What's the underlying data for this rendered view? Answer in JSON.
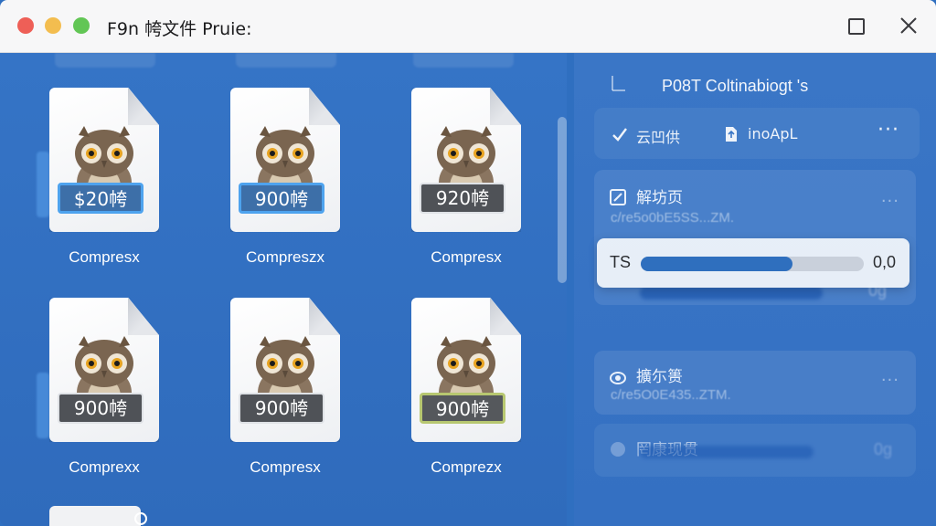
{
  "window": {
    "title": "F9n 㡁文件 Pruie:"
  },
  "files": [
    {
      "price": "$20㡁",
      "label": "Compresx",
      "tag_style": "blue"
    },
    {
      "price": "900㡁",
      "label": "Compreszx",
      "tag_style": "blue"
    },
    {
      "price": "920㡁",
      "label": "Compresx",
      "tag_style": "gray"
    },
    {
      "price": "900㡁",
      "label": "Comprexx",
      "tag_style": "gray"
    },
    {
      "price": "900㡁",
      "label": "Compresx",
      "tag_style": "gray"
    },
    {
      "price": "900㡁",
      "label": "Comprezx",
      "tag_style": "olive"
    }
  ],
  "panel": {
    "title": "P08T Coltinabiogt 's",
    "toolbar": {
      "check_label": "云凹供",
      "upload_label": "inoApL",
      "more": "···"
    },
    "cards": [
      {
        "title": "解坊页",
        "subtitle": "c/re5o0bE5SS...ZM."
      },
      {
        "title": "擴尓篑",
        "subtitle": "c/re5O0E435..ZTM."
      },
      {
        "title": "罔康现贯",
        "subtitle": ""
      }
    ],
    "progress": {
      "label": "TS",
      "value_text": "0,0",
      "fraction": 0.68
    },
    "faded_values": [
      "0g",
      "0g"
    ]
  },
  "colors": {
    "background": "#2f6fc0",
    "titlebar": "#f7f7f8",
    "progress_fill": "#2f6fbe"
  }
}
